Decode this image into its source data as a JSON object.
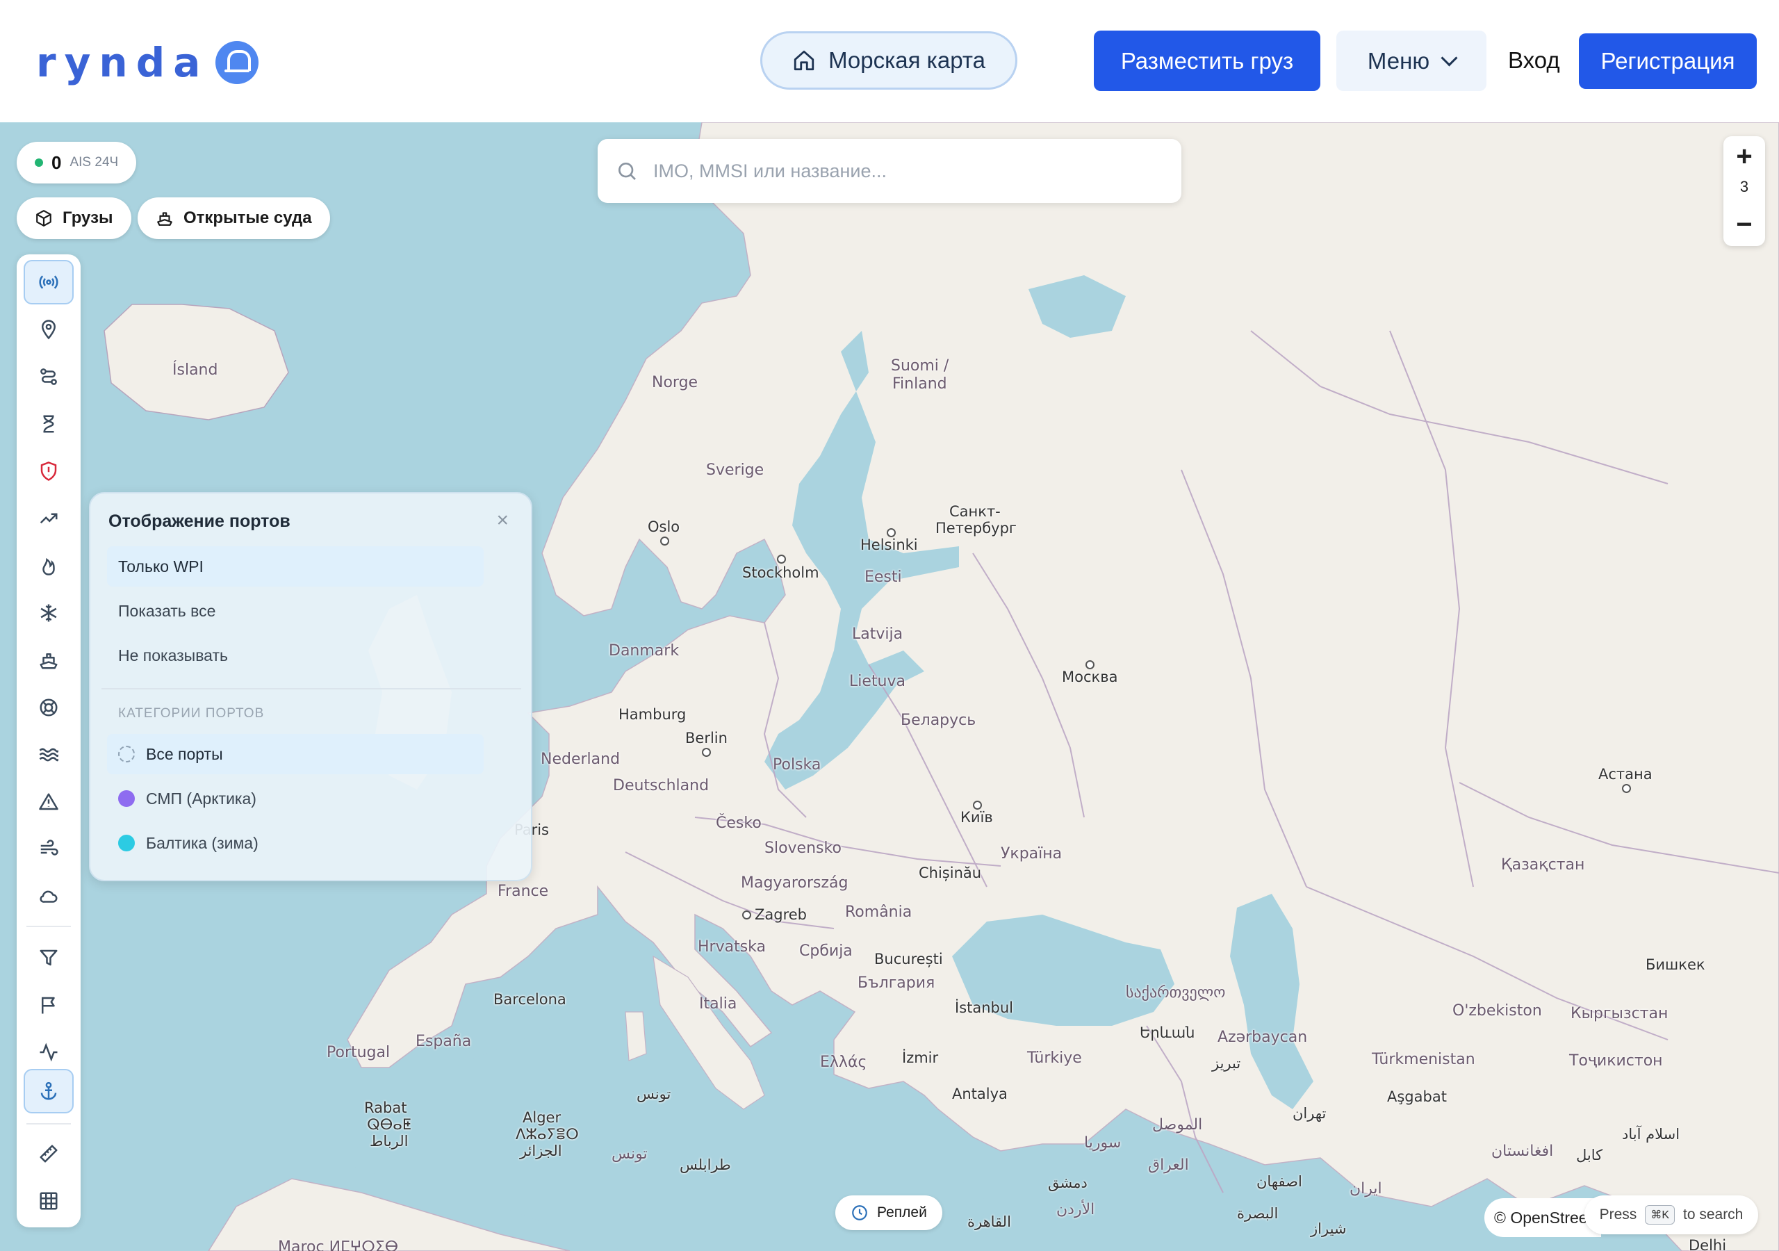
{
  "header": {
    "logo_text": "rynda",
    "sea_map_label": "Морская карта",
    "post_cargo_label": "Разместить груз",
    "menu_label": "Меню",
    "login_label": "Вход",
    "register_label": "Регистрация"
  },
  "ais": {
    "count": "0",
    "label": "AIS 24Ч",
    "status_color": "#22b573"
  },
  "chips": [
    {
      "label": "Грузы",
      "icon": "box-icon"
    },
    {
      "label": "Открытые суда",
      "icon": "ship-icon"
    }
  ],
  "search": {
    "placeholder": "IMO, MMSI или название..."
  },
  "zoom": {
    "level": "3",
    "in_label": "+",
    "out_label": "−"
  },
  "toolbar": {
    "tools": [
      "broadcast-icon",
      "location-pin-icon",
      "route-icon",
      "hourglass-icon",
      "shield-alert-icon",
      "trending-up-icon",
      "flame-icon",
      "snowflake-icon",
      "ship-icon",
      "lifebuoy-icon",
      "waves-icon",
      "warning-icon",
      "wind-icon",
      "cloud-icon",
      "filter-icon",
      "flag-icon",
      "activity-icon",
      "anchor-icon",
      "ruler-icon",
      "grid-icon"
    ],
    "active": [
      "broadcast-icon",
      "anchor-icon"
    ]
  },
  "ports_panel": {
    "title": "Отображение портов",
    "close": "×",
    "display_options": [
      "Только WPI",
      "Показать все",
      "Не показывать"
    ],
    "selected_display": "Только WPI",
    "categories_header": "КАТЕГОРИИ ПОРТОВ",
    "categories": [
      {
        "label": "Все порты",
        "color": ""
      },
      {
        "label": "СМП (Арктика)",
        "color": "#8e6cf0"
      },
      {
        "label": "Балтика (зима)",
        "color": "#2ccbe3"
      }
    ],
    "selected_category": "Все порты"
  },
  "map": {
    "labels": {
      "island": "Ísland",
      "norge": "Norge",
      "suomi": "Suomi /",
      "finland": "Finland",
      "sverige": "Sverige",
      "oslo": "Oslo",
      "stockholm": "Stockholm",
      "helsinki": "Helsinki",
      "spb1": "Санкт-",
      "spb2": "Петербург",
      "eesti": "Eesti",
      "latvija": "Latvija",
      "danmark": "Danmark",
      "lietuva": "Lietuva",
      "moskva": "Москва",
      "hamburg": "Hamburg",
      "berlin": "Berlin",
      "belarus": "Беларусь",
      "nederland": "Nederland",
      "polska": "Polska",
      "deutschland": "Deutschland",
      "astana": "Астана",
      "kyiv": "Київ",
      "cesko": "Česko",
      "paris": "Paris",
      "slovensko": "Slovensko",
      "ukraina": "Україна",
      "chisinau": "Chișinău",
      "kazakhstan": "Қазақстан",
      "france": "France",
      "magyar": "Magyarország",
      "zagreb": "Zagreb",
      "romania": "România",
      "hrvatska": "Hrvatska",
      "srbija": "Србија",
      "bucuresti": "București",
      "bishkek": "Бишкек",
      "bulgaria": "България",
      "barcelona": "Barcelona",
      "italia": "Italia",
      "istanbul": "İstanbul",
      "georgia": "საქართველო",
      "ozbekiston": "O'zbekiston",
      "kyrgyzstan": "Кыргызстан",
      "espana": "España",
      "yerevan": "Երևան",
      "azerbaycan": "Azərbaycan",
      "portugal": "Portugal",
      "ellas": "Ελλάς",
      "izmir": "İzmir",
      "turkiye": "Türkiye",
      "turkmenistan": "Türkmenistan",
      "tojikiston": "Тоҷикистон",
      "tabriz": "تبریز",
      "ashgabat": "Aşgabat",
      "tunis": "تونس",
      "antalya": "Antalya",
      "rabat": "Rabat",
      "alger": "Alger",
      "tehran": "تهران",
      "mosul": "الموصل",
      "syria": "سوريا",
      "tripoli": "طرابلس",
      "iraq": "العراق",
      "isfahan": "اصفهان",
      "iran": "ایران",
      "afghanistan": "افغانستان",
      "kabul": "کابل",
      "islamabad": "اسلام آباد",
      "cairo": "القاهرة",
      "basra": "البصرة",
      "shiraz": "شیراز",
      "dimashq": "دمشق",
      "jordan": "الأردن",
      "delhi": "Delhi",
      "maroc": "Maroc ⵍⵎⵖⵔⵉⴱ",
      "rabat_tif": "ⵕⴱⴰⵟ",
      "rabat_ar": "الرباط",
      "alger_tif": "ⴷⵣⴰⵢⴻⵔ",
      "alger_ar": "الجزائر",
      "tunis_ar": "تونس"
    }
  },
  "replay": {
    "label": "Реплей"
  },
  "attribution": {
    "text": "© OpenStreetMap"
  },
  "search_hint": {
    "press": "Press",
    "key": "⌘K",
    "rest": "to search"
  }
}
